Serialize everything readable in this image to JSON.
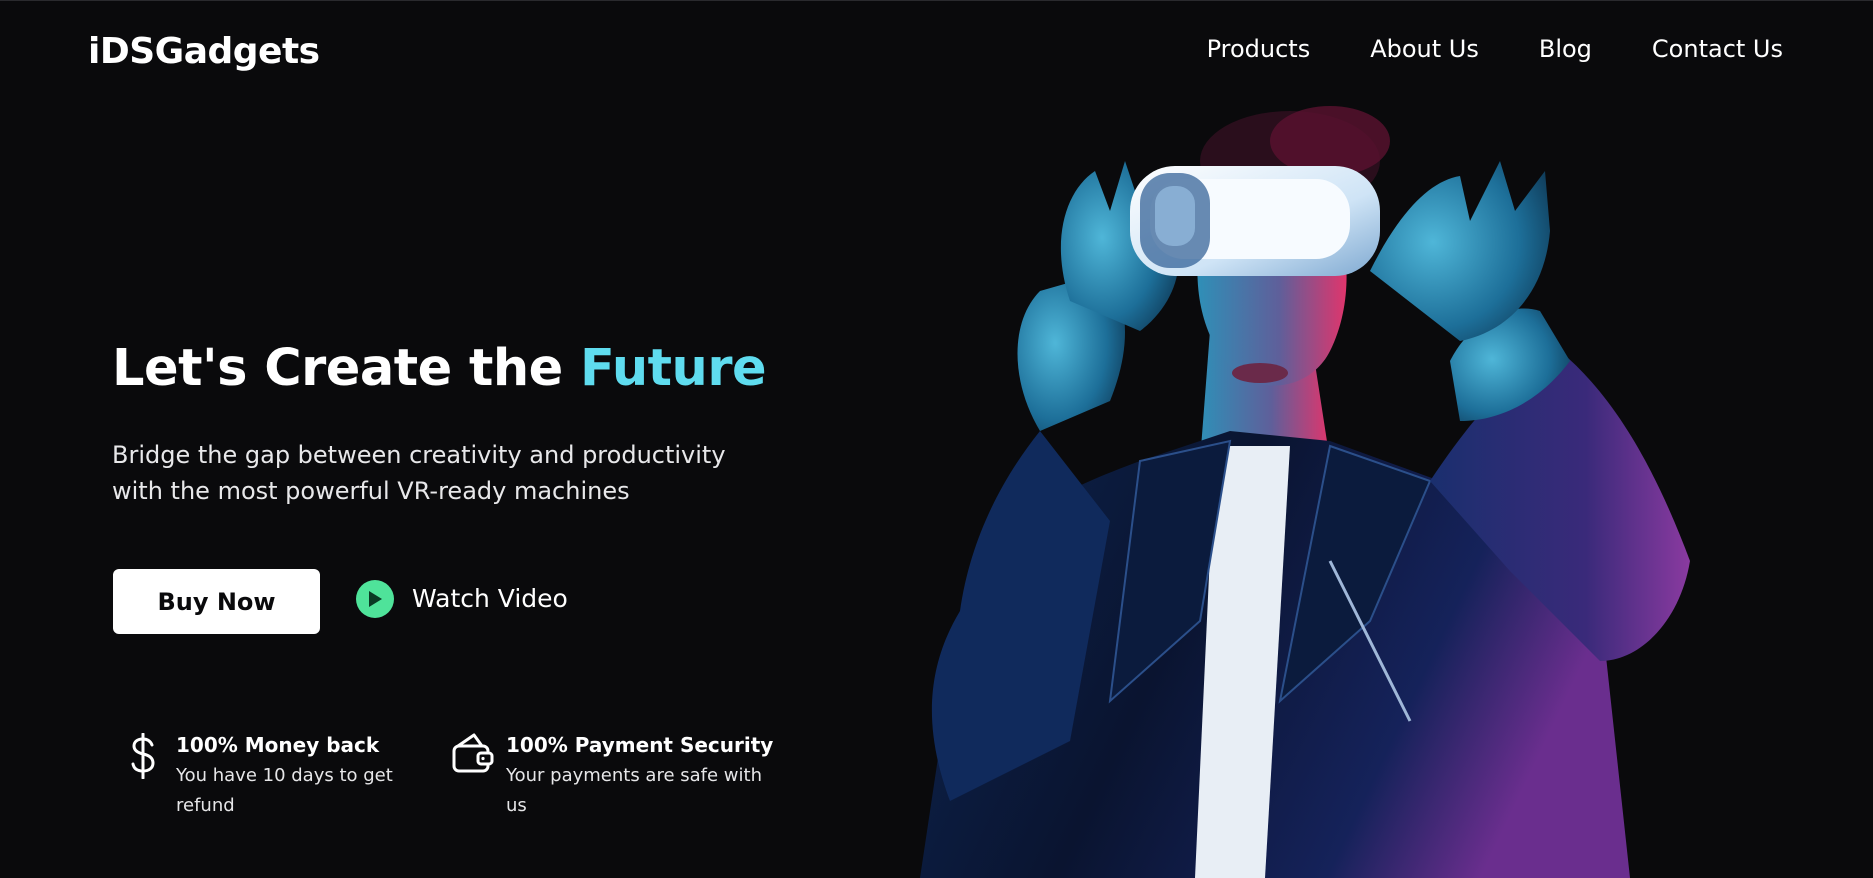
{
  "brand": {
    "name": "iDSGadgets"
  },
  "nav": {
    "items": [
      {
        "label": "Products"
      },
      {
        "label": "About Us"
      },
      {
        "label": "Blog"
      },
      {
        "label": "Contact Us"
      }
    ]
  },
  "hero": {
    "title_main": "Let's Create the ",
    "title_accent": "Future",
    "subtitle": "Bridge the gap between creativity and productivity with the most powerful VR-ready machines",
    "buy_label": "Buy Now",
    "watch_label": "Watch Video",
    "image_icon": "vr-headset-person-image"
  },
  "features": [
    {
      "icon": "dollar-icon",
      "title": "100% Money back",
      "desc": "You have 10 days to get refund"
    },
    {
      "icon": "wallet-icon",
      "title": "100% Payment Security",
      "desc": "Your payments are safe with us"
    }
  ],
  "colors": {
    "background": "#0a0a0c",
    "accent": "#5fdcef",
    "play": "#4fe39a",
    "button_bg": "#ffffff"
  }
}
